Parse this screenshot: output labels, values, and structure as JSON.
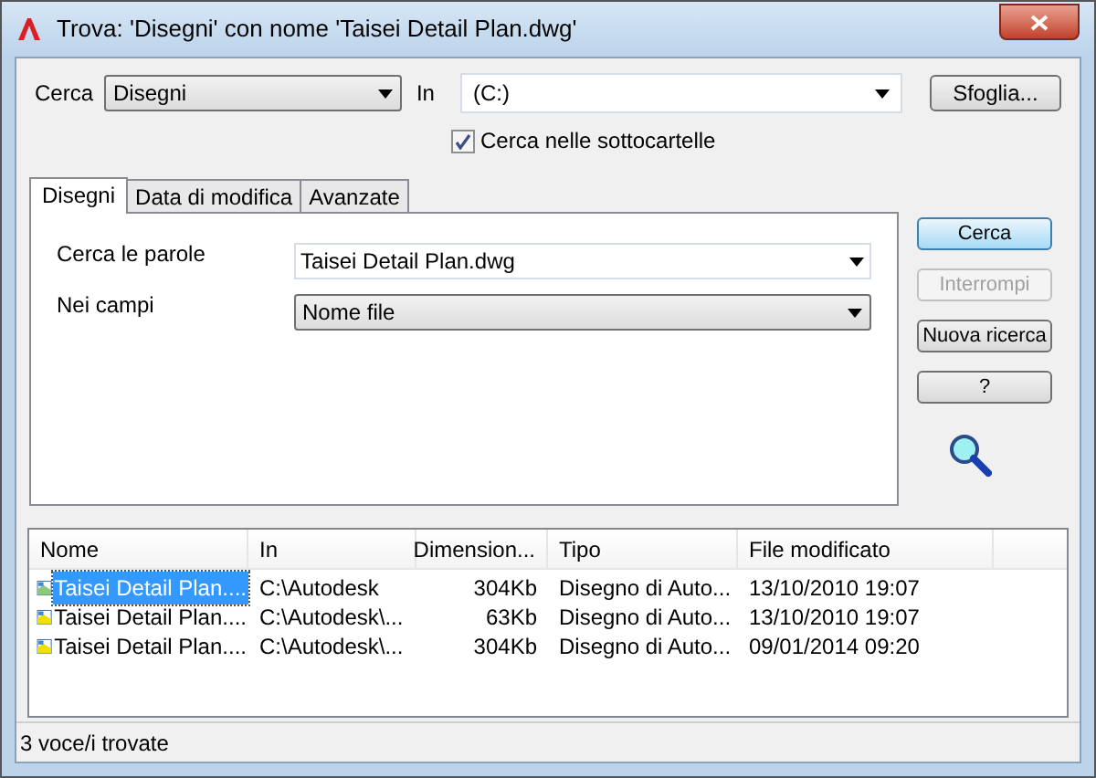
{
  "window": {
    "title": "Trova: 'Disegni' con nome 'Taisei Detail Plan.dwg'"
  },
  "search_type": {
    "label": "Cerca",
    "value": "Disegni"
  },
  "location": {
    "label": "In",
    "value": "(C:)"
  },
  "browse_button": "Sfoglia...",
  "subfolders": {
    "label": "Cerca nelle sottocartelle",
    "checked": true
  },
  "tabs": [
    {
      "label": "Disegni",
      "selected": true
    },
    {
      "label": "Data di modifica",
      "selected": false
    },
    {
      "label": "Avanzate",
      "selected": false
    }
  ],
  "words": {
    "label": "Cerca le parole",
    "value": "Taisei Detail Plan.dwg"
  },
  "fields": {
    "label": "Nei campi",
    "value": "Nome file"
  },
  "buttons": [
    {
      "label": "Cerca",
      "kind": "default",
      "disabled": false
    },
    {
      "label": "Interrompi",
      "kind": "normal",
      "disabled": true
    },
    {
      "label": "Nuova ricerca",
      "kind": "normal",
      "disabled": false
    },
    {
      "label": "?",
      "kind": "normal",
      "disabled": false
    }
  ],
  "table": {
    "columns": [
      "Nome",
      "In",
      "Dimension...",
      "Tipo",
      "File modificato"
    ],
    "rows": [
      {
        "selected": true,
        "color": "#8fc87a",
        "cells": [
          "Taisei Detail Plan....",
          "C:\\Autodesk",
          "304Kb",
          "Disegno di Auto...",
          "13/10/2010 19:07"
        ]
      },
      {
        "selected": false,
        "color": "#f0e000",
        "cells": [
          "Taisei Detail Plan....",
          "C:\\Autodesk\\...",
          "63Kb",
          "Disegno di Auto...",
          "13/10/2010 19:07"
        ]
      },
      {
        "selected": false,
        "color": "#f0e000",
        "cells": [
          "Taisei Detail Plan....",
          "C:\\Autodesk\\...",
          "304Kb",
          "Disegno di Auto...",
          "09/01/2014 09:20"
        ]
      }
    ]
  },
  "status_bar": "3 voce/i trovate"
}
